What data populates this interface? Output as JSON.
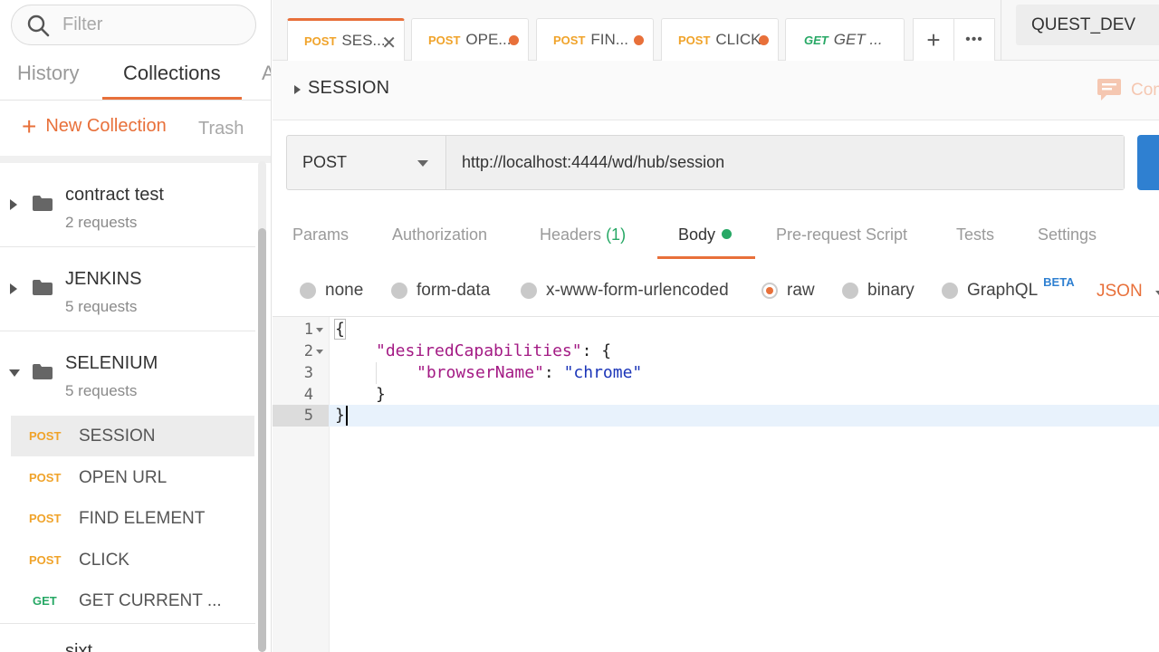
{
  "sidebar": {
    "filter_placeholder": "Filter",
    "tabs": [
      "History",
      "Collections",
      "A"
    ],
    "new_collection": "New Collection",
    "trash": "Trash",
    "folders": [
      {
        "name": "contract test",
        "count": "2 requests"
      },
      {
        "name": "JENKINS",
        "count": "5 requests"
      },
      {
        "name": "SELENIUM",
        "count": "5 requests"
      }
    ],
    "requests": [
      {
        "method": "POST",
        "name": "SESSION"
      },
      {
        "method": "POST",
        "name": "OPEN URL"
      },
      {
        "method": "POST",
        "name": "FIND ELEMENT"
      },
      {
        "method": "POST",
        "name": "CLICK"
      },
      {
        "method": "GET",
        "name": "GET CURRENT ..."
      }
    ],
    "cut_folder": "sixt"
  },
  "tabbar": {
    "tabs": [
      {
        "method": "POST",
        "name": "SES..."
      },
      {
        "method": "POST",
        "name": "OPE..."
      },
      {
        "method": "POST",
        "name": "FIN..."
      },
      {
        "method": "POST",
        "name": "CLICK"
      },
      {
        "method": "GET",
        "name": "GET ..."
      }
    ],
    "close_glyph": "✕",
    "add_glyph": "+",
    "more_glyph": "•••",
    "environment": "QUEST_DEV"
  },
  "request": {
    "title": "SESSION",
    "comment_label": "Comments",
    "method": "POST",
    "url": "http://localhost:4444/wd/hub/session",
    "tabs": {
      "params": "Params",
      "authorization": "Authorization",
      "headers": "Headers",
      "headers_count": "(1)",
      "body": "Body",
      "prerequest": "Pre-request Script",
      "tests": "Tests",
      "settings": "Settings"
    },
    "body_types": {
      "none": "none",
      "form_data": "form-data",
      "urlencoded": "x-www-form-urlencoded",
      "raw": "raw",
      "binary": "binary",
      "graphql": "GraphQL",
      "beta": "BETA",
      "format": "JSON"
    }
  },
  "editor": {
    "line_numbers": [
      "1",
      "2",
      "3",
      "4",
      "5"
    ],
    "open_brace": "{",
    "key_desired": "\"desiredCapabilities\"",
    "colon_open": ": {",
    "key_browser": "\"browserName\"",
    "colon": ": ",
    "value_browser": "\"chrome\"",
    "inner_close": "}",
    "outer_close": "}"
  },
  "colors": {
    "accent": "#e8703a",
    "post": "#f0a32a",
    "get": "#27a865",
    "send": "#2f80d1"
  }
}
